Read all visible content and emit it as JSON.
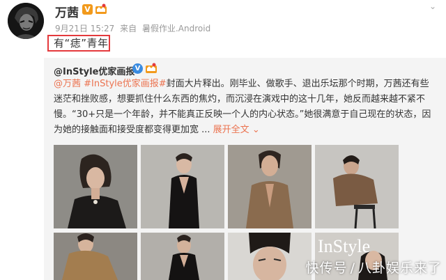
{
  "post": {
    "author": "万茜",
    "verified_badge": "V",
    "time": "9月21日 15:27",
    "source_prefix": "来自",
    "source": "暑假作业.Android",
    "title": "有“痣”青年"
  },
  "repost": {
    "author": "@InStyle优家画报",
    "verified_badge": "V",
    "mention": "@万茜",
    "hashtag": "#InStyle优家画报#",
    "text": "封面大片释出。刚毕业、做歌手、退出乐坛那个时期，万茜还有些迷茫和挫败感，想要抓住什么东西的焦灼，而沉浸在演戏中的这十几年，她反而越来越不紧不慢。“30+只是一个年龄，并不能真正反映一个人的内心状态。”她很满意于自己现在的状态，因为她的接触面和接受度都变得更加宽 ...",
    "expand_label": "展开全文",
    "expand_icon": "chevron-down-icon",
    "cover_text": "InStyle"
  },
  "watermark": {
    "left": "快传号",
    "sep": "/",
    "right": "八卦娱乐来了"
  },
  "colors": {
    "link_orange": "#eb7350",
    "highlight_red": "#e4393c",
    "repost_bg": "#f4f4f4",
    "vip_gold": "#f29a1c"
  }
}
